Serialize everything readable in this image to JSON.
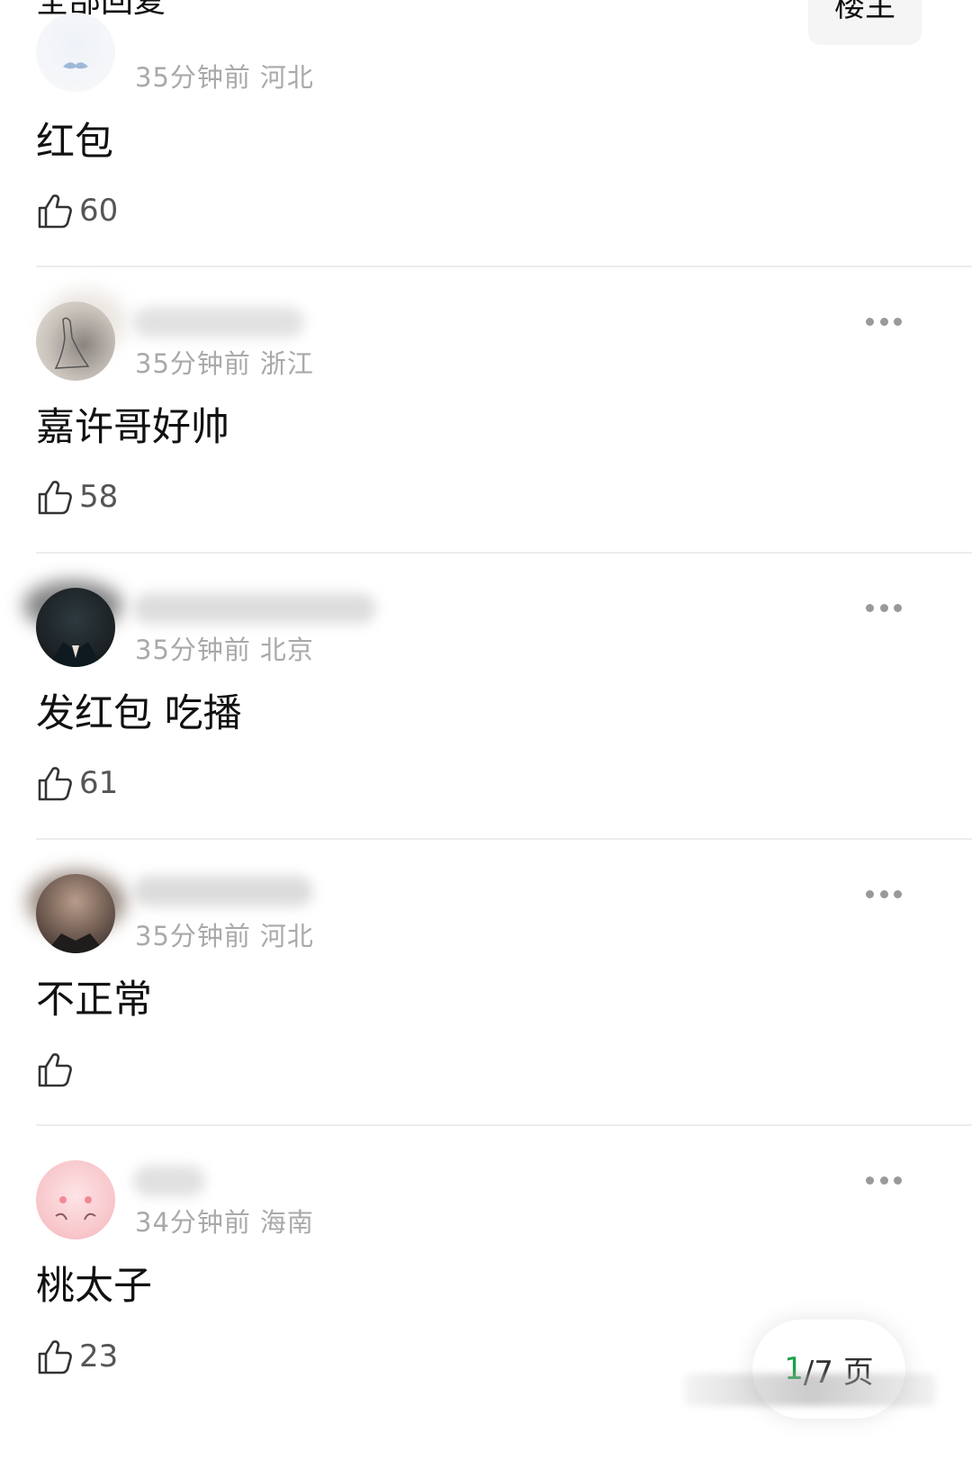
{
  "header": {
    "title": "全部回复",
    "filter_label": "楼主"
  },
  "comments": [
    {
      "time": "35分钟前",
      "location": "河北",
      "content": "红包",
      "likes": "60"
    },
    {
      "time": "35分钟前",
      "location": "浙江",
      "content": "嘉许哥好帅",
      "likes": "58"
    },
    {
      "time": "35分钟前",
      "location": "北京",
      "content": "发红包 吃播",
      "likes": "61"
    },
    {
      "time": "35分钟前",
      "location": "河北",
      "content": "不正常",
      "likes": ""
    },
    {
      "time": "34分钟前",
      "location": "海南",
      "content": "桃太子",
      "likes": "23"
    }
  ],
  "pager": {
    "current": "1",
    "total_text": "/7 页"
  },
  "icons": {
    "like": "thumbs-up-icon",
    "more": "more-dots-icon"
  },
  "colors": {
    "meta_text": "#a9a9a9",
    "pager_current": "#1aa34a",
    "divider": "#ededed"
  }
}
